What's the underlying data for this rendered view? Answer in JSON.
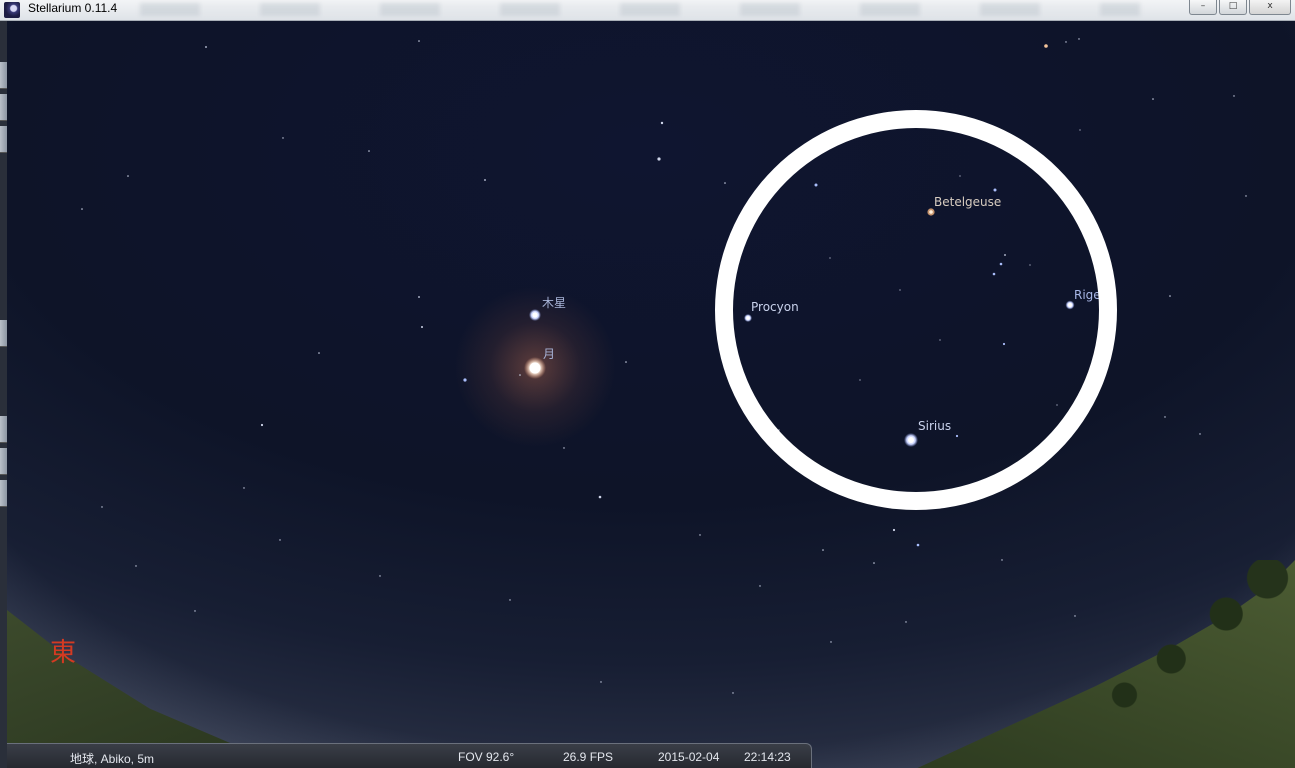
{
  "window": {
    "title": "Stellarium 0.11.4",
    "controls": [
      "–",
      "□",
      "x"
    ]
  },
  "sky_labels": {
    "jupiter": "木星",
    "moon": "月",
    "procyon": "Procyon",
    "betelgeuse": "Betelgeuse",
    "rigel": "Rige",
    "sirius": "Sirius"
  },
  "cardinal_point": "東",
  "status": {
    "location": "地球, Abiko, 5m",
    "fov": "FOV 92.6°",
    "fps": "26.9 FPS",
    "date": "2015-02-04",
    "time": "22:14:23"
  },
  "colors": {
    "sky": "#0e1428",
    "ring": "#ffffff",
    "cardinal": "#d33a22",
    "label": "#a8b4d8"
  },
  "icons": [
    "stellarium-app-icon",
    "minimize-icon",
    "maximize-icon",
    "close-icon"
  ]
}
